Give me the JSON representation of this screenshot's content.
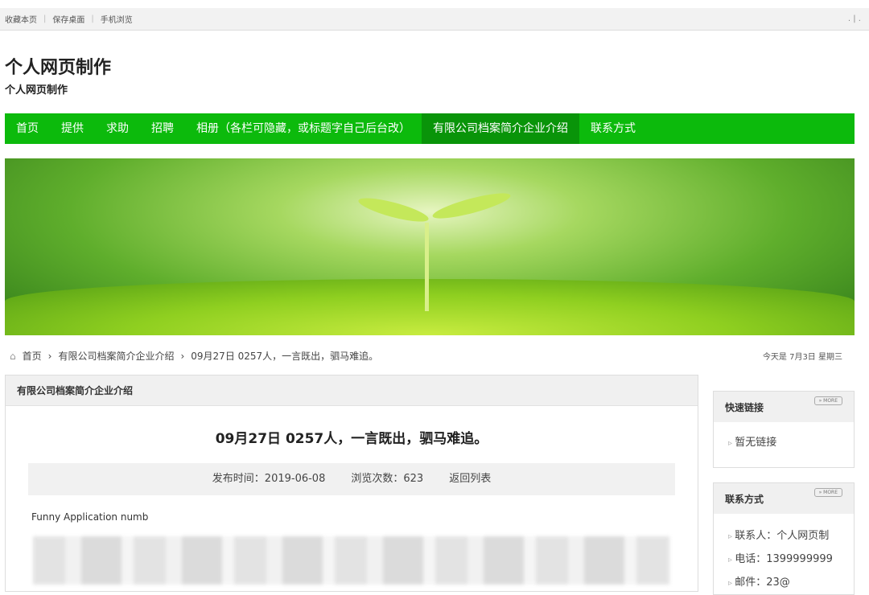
{
  "topbar": {
    "links": [
      "收藏本页",
      "保存桌面",
      "手机浏览"
    ],
    "right": ". | ."
  },
  "site": {
    "title": "个人网页制作",
    "subtitle": "个人网页制作"
  },
  "nav": [
    "首页",
    "提供",
    "求助",
    "招聘",
    "相册（各栏可隐藏，或标题字自己后台改）",
    "有限公司档案简介企业介绍",
    "联系方式"
  ],
  "breadcrumb": [
    "首页",
    "有限公司档案简介企业介绍",
    "09月27日 0257人，一言既出，驷马难追。"
  ],
  "date": "今天是 7月3日 星期三",
  "article": {
    "section": "有限公司档案简介企业介绍",
    "title": "09月27日 0257人，一言既出，驷马难追。",
    "publish": "发布时间：2019-06-08",
    "views": "浏览次数：623",
    "back": "返回列表",
    "text": "Funny Application numb"
  },
  "sidebar": {
    "more": "» MORE",
    "quick": {
      "title": "快速链接",
      "items": [
        "暂无链接"
      ]
    },
    "contact": {
      "title": "联系方式",
      "items": [
        "联系人：个人网页制",
        "电话：1399999999",
        "邮件：23@"
      ]
    }
  }
}
